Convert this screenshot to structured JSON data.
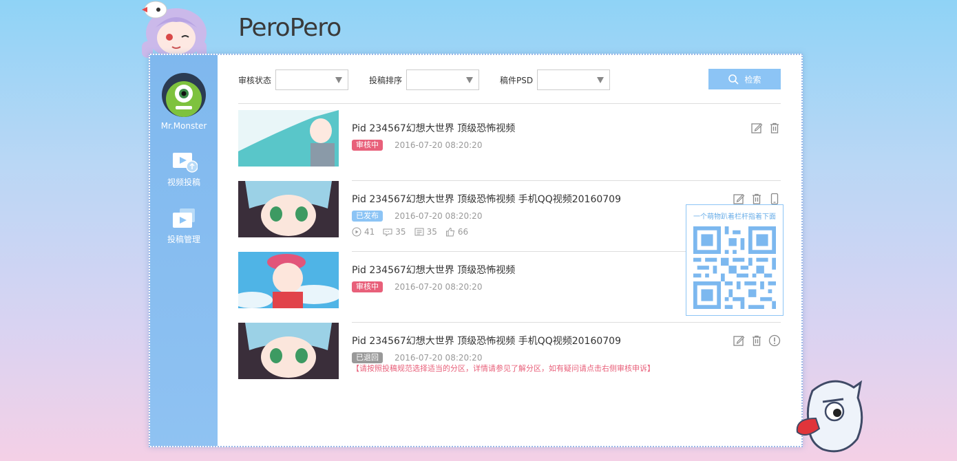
{
  "logo": "PeroPero",
  "user": {
    "name": "Mr.Monster"
  },
  "sidebar": {
    "items": [
      {
        "label": "视频投稿",
        "icon": "video-upload-icon"
      },
      {
        "label": "投稿管理",
        "icon": "video-manage-icon"
      }
    ]
  },
  "filters": {
    "status_label": "审核状态",
    "sort_label": "投稿排序",
    "psd_label": "稿件PSD",
    "status_value": "",
    "sort_value": "",
    "psd_value": "",
    "search_label": "检索"
  },
  "videos": [
    {
      "title": "Pid  234567幻想大世界 顶级恐怖视频",
      "status": "审核中",
      "status_color": "#e8607a",
      "date": "2016-07-20 08:20:20"
    },
    {
      "title": "Pid  234567幻想大世界 顶级恐怖视频 手机QQ视频20160709",
      "status": "已发布",
      "status_color": "#8cc4f5",
      "date": "2016-07-20 08:20:20",
      "stats": {
        "plays": "41",
        "danmaku": "35",
        "comments": "35",
        "likes": "66"
      }
    },
    {
      "title": "Pid  234567幻想大世界 顶级恐怖视频",
      "status": "审核中",
      "status_color": "#e8607a",
      "date": "2016-07-20 08:20:20"
    },
    {
      "title": "Pid  234567幻想大世界 顶级恐怖视频 手机QQ视频20160709",
      "status": "已退回",
      "status_color": "#999999",
      "date": "2016-07-20 08:20:20",
      "notice": "【请按照投稿规范选择适当的分区，详情请参见了解分区，如有疑问请点击右侧审核申诉】"
    }
  ],
  "qr_popup": {
    "title": "一个萌物趴着栏杆指着下面"
  }
}
